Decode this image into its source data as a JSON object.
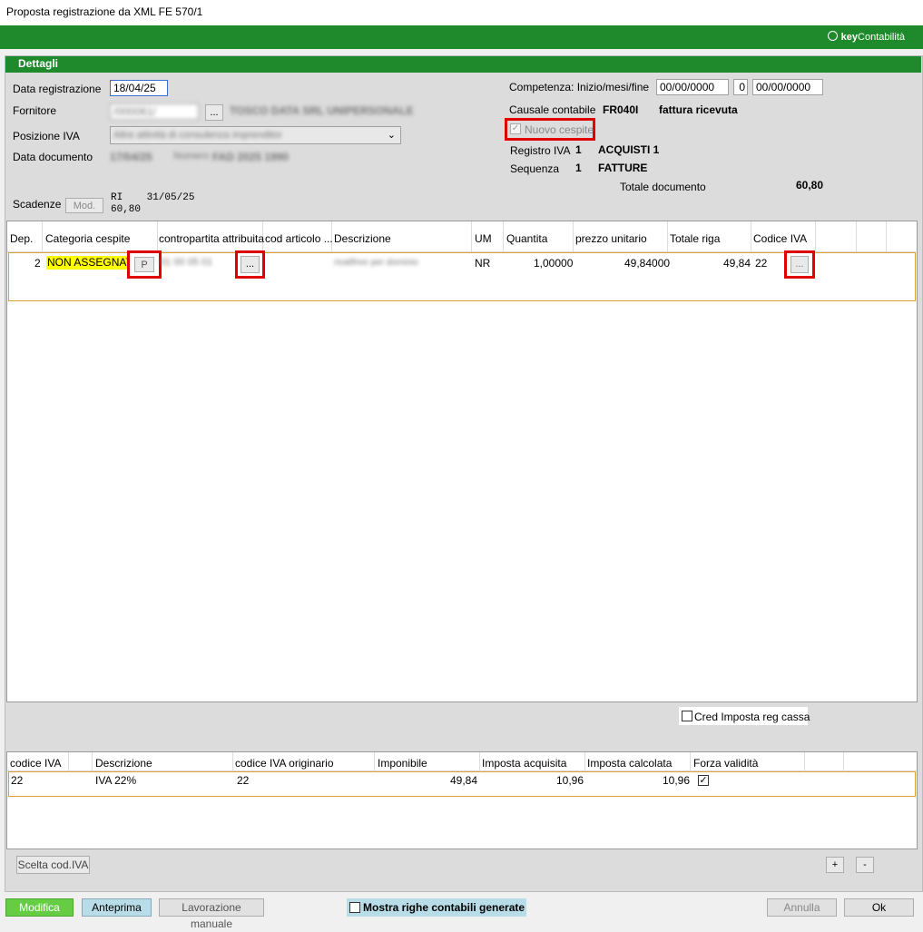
{
  "window": {
    "title": "Proposta registrazione da XML FE 570/1"
  },
  "brand": {
    "key": "key",
    "name": "Contabilità"
  },
  "panel": {
    "title": "Dettagli"
  },
  "form": {
    "data_registrazione_label": "Data registrazione",
    "data_registrazione_value": "18/04/25",
    "fornitore_label": "Fornitore",
    "fornitore_code": "/000061/",
    "fornitore_name": "TOSCO DATA SRL UNIPERSONALE",
    "browse_label": "...",
    "posizione_iva_label": "Posizione IVA",
    "posizione_iva_value": "Altre attività di consulenza imprenditor",
    "data_documento_label": "Data documento",
    "data_documento_value": "17/04/25",
    "numero_label": "Numero",
    "numero_value": "FAD 2025 1990",
    "scadenze_label": "Scadenze",
    "mod_label": "Mod.",
    "scadenze_line1": "RI    31/05/25",
    "scadenze_line2": "60,80"
  },
  "right": {
    "competenza_label": "Competenza: Inizio/mesi/fine",
    "competenza_inizio": "00/00/0000",
    "competenza_mesi": "0",
    "competenza_fine": "00/00/0000",
    "causale_label": "Causale contabile",
    "causale_code": "FR040I",
    "causale_desc": "fattura ricevuta",
    "nuovo_cespite_label": "Nuovo cespite",
    "registro_label": "Registro IVA",
    "registro_num": "1",
    "registro_desc": "ACQUISTI 1",
    "sequenza_label": "Sequenza",
    "sequenza_num": "1",
    "sequenza_desc": "FATTURE",
    "totale_label": "Totale documento",
    "totale_value": "60,80"
  },
  "rows_table": {
    "headers": [
      "Dep.",
      "Categoria cespite",
      "contropartita attribuita",
      "cod articolo ...",
      "Descrizione",
      "UM",
      "Quantita",
      "prezzo unitario",
      "Totale riga",
      "Codice IVA"
    ],
    "row": {
      "dep": "2",
      "categoria": "NON ASSEGNATA",
      "p_button": "P",
      "contropartita": "01 00 05 01",
      "browse": "...",
      "descrizione": "rivalifree per dominio",
      "um": "NR",
      "quantita": "1,00000",
      "prezzo": "49,84000",
      "totale": "49,84",
      "codice_iva": "22",
      "browse_iva": "..."
    }
  },
  "cred_imposta_label": "Cred Imposta reg cassa",
  "iva_table": {
    "headers": [
      "codice IVA",
      "Descrizione",
      "codice IVA originario",
      "Imponibile",
      "Imposta acquisita",
      "Imposta calcolata",
      "Forza validità"
    ],
    "row": {
      "codice": "22",
      "descrizione": "IVA 22%",
      "originario": "22",
      "imponibile": "49,84",
      "acquisita": "10,96",
      "calcolata": "10,96",
      "forza_check": "✓"
    }
  },
  "scelta_label": "Scelta cod.IVA",
  "plus_label": "+",
  "minus_label": "-",
  "footer": {
    "modifica": "Modifica",
    "anteprima": "Anteprima",
    "lavorazione": "Lavorazione manuale",
    "mostra": "Mostra righe contabili generate",
    "annulla": "Annulla",
    "ok": "Ok"
  },
  "colors": {
    "green": "#1f8a2c",
    "highlight": "#ffff00",
    "red": "#e00000",
    "modifica": "#66cc44",
    "anteprima": "#b8dde8"
  }
}
